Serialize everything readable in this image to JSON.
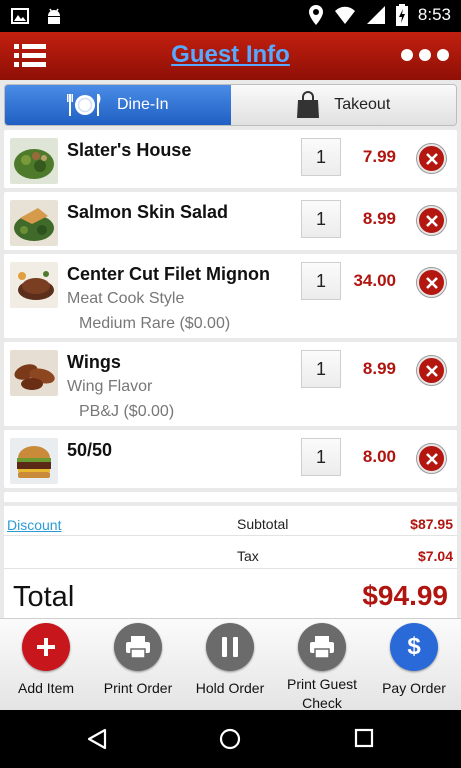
{
  "status_bar": {
    "time": "8:53",
    "left_icons": [
      "image-icon",
      "android-icon"
    ],
    "right_icons": [
      "location-icon",
      "wifi-icon",
      "signal-icon",
      "battery-charging-icon"
    ]
  },
  "header": {
    "title": "Guest Info",
    "left_icon": "list-menu-icon",
    "right_icon": "more-dots-icon",
    "background": "#a8170a",
    "title_color": "#58a8ff"
  },
  "tabs": [
    {
      "label": "Dine-In",
      "icon": "plate-cutlery-icon",
      "active": true
    },
    {
      "label": "Takeout",
      "icon": "shopping-bag-icon",
      "active": false
    }
  ],
  "order_items": [
    {
      "name": "Slater's House",
      "qty": "1",
      "price": "7.99",
      "modifier_label": "",
      "modifier_value": ""
    },
    {
      "name": "Salmon Skin Salad",
      "qty": "1",
      "price": "8.99",
      "modifier_label": "",
      "modifier_value": ""
    },
    {
      "name": "Center Cut Filet Mignon",
      "qty": "1",
      "price": "34.00",
      "modifier_label": "Meat Cook Style",
      "modifier_value": "Medium Rare  ($0.00)"
    },
    {
      "name": "Wings",
      "qty": "1",
      "price": "8.99",
      "modifier_label": "Wing Flavor",
      "modifier_value": "PB&J  ($0.00)"
    },
    {
      "name": "50/50",
      "qty": "1",
      "price": "8.00",
      "modifier_label": "",
      "modifier_value": ""
    }
  ],
  "totals": {
    "discount_label": "Discount",
    "subtotal_label": "Subtotal",
    "subtotal_value": "$87.95",
    "tax_label": "Tax",
    "tax_value": "$7.04",
    "total_label": "Total",
    "total_value": "$94.99"
  },
  "actions": [
    {
      "label": "Add Item",
      "icon": "plus-icon",
      "color": "#c8161d"
    },
    {
      "label": "Print Order",
      "icon": "printer-icon",
      "color": "#6b6b6b"
    },
    {
      "label": "Hold Order",
      "icon": "pause-icon",
      "color": "#6b6b6b"
    },
    {
      "label": "Print Guest Check",
      "icon": "printer-icon",
      "color": "#6b6b6b"
    },
    {
      "label": "Pay Order",
      "icon": "dollar-icon",
      "color": "#2a6ad8"
    }
  ],
  "nav_bar": [
    "back-icon",
    "home-icon",
    "recents-icon"
  ],
  "colors": {
    "price_red": "#b01510",
    "accent_blue": "#2a6ad8",
    "link_blue": "#2a9bd6"
  }
}
